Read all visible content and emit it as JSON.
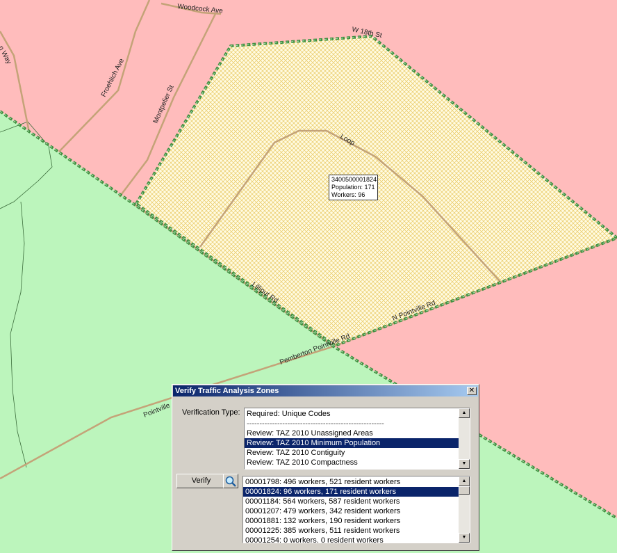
{
  "map": {
    "road_labels": [
      "Woodcock Ave",
      "Froehlich Ave",
      "Montpelier St",
      "W 18th St",
      "Loop",
      "Lilliput Rd",
      "N Pointville Rd",
      "Pemberton Pointville Rd",
      "Pointville",
      "n Way"
    ],
    "tooltip": {
      "zone_id": "3400500001824",
      "population": "Population: 171",
      "workers": "Workers: 96"
    },
    "colors": {
      "zone_pink": "#ffbcbc",
      "zone_green": "#bcf5bc",
      "selected_zone": "#fffbe2",
      "selected_hatch": "#e8c860",
      "boundary_green": "#3f8f3f",
      "road": "#c4a378"
    }
  },
  "dialog": {
    "title": "Verify Traffic Analysis Zones",
    "close_symbol": "✕",
    "verification_type_label": "Verification Type:",
    "verification_types": [
      "Required: Unique Codes",
      "------------------------------------------------------",
      "Review: TAZ 2010 Unassigned Areas",
      "Review: TAZ 2010 Minimum Population",
      "Review: TAZ 2010 Contiguity",
      "Review: TAZ 2010 Compactness"
    ],
    "selected_verification_index": 3,
    "verify_button": "Verify",
    "zoom_icon": "magnifier-icon",
    "results": [
      "00001798: 496 workers, 521 resident workers",
      "00001824: 96 workers, 171 resident workers",
      "00001184: 564 workers, 587 resident workers",
      "00001207: 479 workers, 342 resident workers",
      "00001881: 132 workers, 190 resident workers",
      "00001225: 385 workers, 511 resident workers",
      "00001254: 0 workers, 0 resident workers"
    ],
    "selected_result_index": 1
  }
}
